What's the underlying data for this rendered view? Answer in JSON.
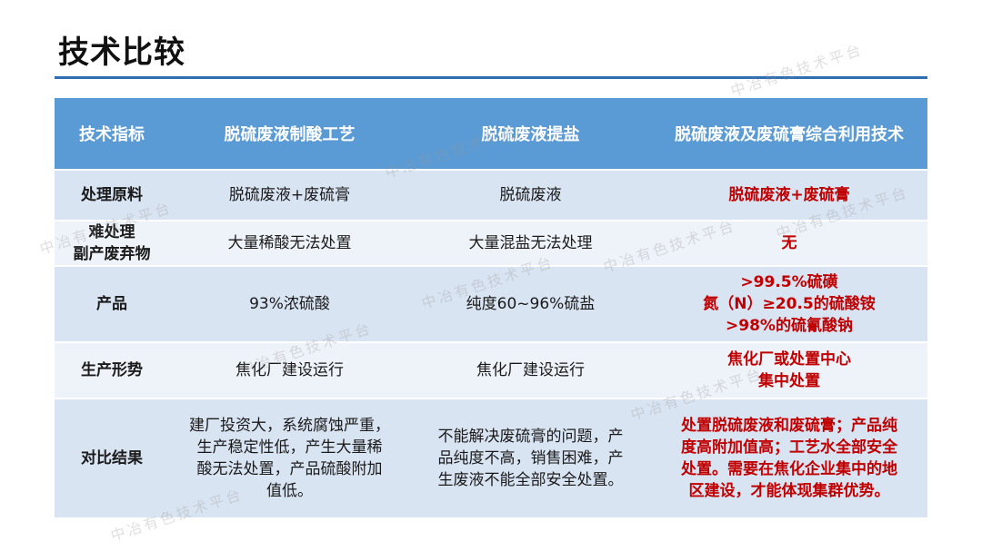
{
  "page": {
    "title": "技术比较"
  },
  "watermark_text": "中冶有色技术平台",
  "colors": {
    "header_bg": "#5b9bd5",
    "rule": "#2e6fb4",
    "row_odd": "#d9e4f3",
    "row_even": "#eef3fa",
    "highlight": "#c00000"
  },
  "table": {
    "headers": [
      "技术指标",
      "脱硫废液制酸工艺",
      "脱硫废液提盐",
      "脱硫废液及废硫膏综合利用技术"
    ],
    "rows": [
      {
        "label": [
          "处理原料"
        ],
        "c1": [
          "脱硫废液+废硫膏"
        ],
        "c2": [
          "脱硫废液"
        ],
        "c3": [
          "脱硫废液+废硫膏"
        ]
      },
      {
        "label": [
          "难处理",
          "副产废弃物"
        ],
        "c1": [
          "大量稀酸无法处置"
        ],
        "c2": [
          "大量混盐无法处理"
        ],
        "c3": [
          "无"
        ]
      },
      {
        "label": [
          "产品"
        ],
        "c1": [
          "93%浓硫酸"
        ],
        "c2": [
          "纯度60~96%硫盐"
        ],
        "c3": [
          ">99.5%硫磺",
          "氮（N）≥20.5的硫酸铵",
          ">98%的硫氰酸钠"
        ]
      },
      {
        "label": [
          "生产形势"
        ],
        "c1": [
          "焦化厂建设运行"
        ],
        "c2": [
          "焦化厂建设运行"
        ],
        "c3": [
          "焦化厂或处置中心",
          "集中处置"
        ]
      },
      {
        "label": [
          "对比结果"
        ],
        "c1": [
          "建厂投资大，系统腐蚀严重，",
          "生产稳定性低，产生大量稀",
          "酸无法处置，产品硫酸附加",
          "值低。"
        ],
        "c2": [
          "不能解决废硫膏的问题，产",
          "品纯度不高，销售困难，产",
          "生废液不能全部安全处置。"
        ],
        "c3": [
          "处置脱硫废液和废硫膏；产品纯",
          "度高附加值高；工艺水全部安全",
          "处置。需要在焦化企业集中的地",
          "区建设，才能体现集群优势。"
        ]
      }
    ]
  }
}
